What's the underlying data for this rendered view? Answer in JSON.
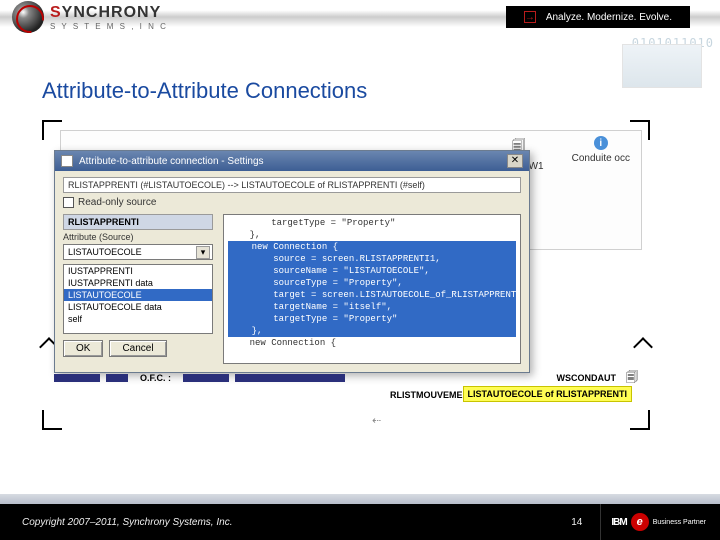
{
  "brand": {
    "name_a": "S",
    "name_b": "YNCHRONY",
    "sub": "S Y S T E M S ,  I N C"
  },
  "tagline": {
    "text": "Analyze. Modernize. Evolve.",
    "arrow": "→"
  },
  "deco": {
    "digits": "0101011010"
  },
  "slide": {
    "title": "Attribute-to-Attribute Connections"
  },
  "bg": {
    "rtarifw1": "RTARIFW1",
    "conduite": "Conduite occ"
  },
  "dialog": {
    "title": "Attribute-to-attribute connection - Settings",
    "close": "✕",
    "path": "RLISTAPPRENTI (#LISTAUTOECOLE) --> LISTAUTOECOLE of RLISTAPPRENTI (#self)",
    "readonly_label": "Read-only source",
    "group": "RLISTAPPRENTI",
    "attr_label": "Attribute (Source)",
    "combo_value": "LISTAUTOECOLE",
    "list": [
      "IUSTAPPRENTI",
      "IUSTAPPRENTI data",
      "LISTAUTOECOLE",
      "LISTAUTOECOLE data",
      "self"
    ],
    "selected_index": 2,
    "ok": "OK",
    "cancel": "Cancel"
  },
  "code": {
    "pre": "        targetType = \"Property\"\n    },",
    "hl": "    new Connection {\n        source = screen.RLISTAPPRENTI1,\n        sourceName = \"LISTAUTOECOLE\",\n        sourceType = \"Property\",\n        target = screen.LISTAUTOECOLE_of_RLISTAPPRENTI,\n        targetName = \"itself\",\n        targetType = \"Property\"\n    },",
    "post": "    new Connection {"
  },
  "bottom": {
    "ofc": "O.F.C. :",
    "wscondaut": "WSCONDAUT",
    "rlistmouv": "RLISTMOUVEMENT",
    "highlight": "LISTAUTOECOLE of RLISTAPPRENTI"
  },
  "footer": {
    "copyright": "Copyright 2007–2011, Synchrony Systems, Inc.",
    "page": "14",
    "ibm": "IBM",
    "e": "e",
    "bp": "Business\nPartner"
  },
  "icons": {
    "file": "🗐",
    "info": "i",
    "arrow": "⇠"
  }
}
